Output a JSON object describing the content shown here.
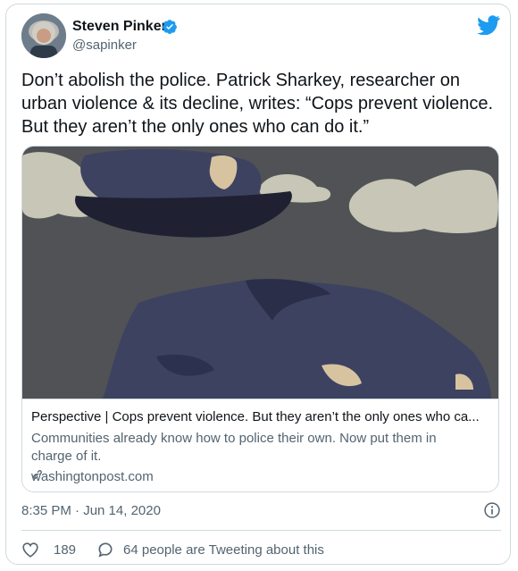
{
  "author": {
    "name": "Steven Pinker",
    "handle": "@sapinker"
  },
  "tweet_text": "Don’t abolish the police. Patrick Sharkey, researcher on urban violence & its decline, writes: “Cops prevent violence. But they aren’t the only ones who can do it.”",
  "link_card": {
    "title": "Perspective | Cops prevent violence. But they aren’t the only ones who ca...",
    "description": "Communities already know how to police their own. Now put them in charge of it.",
    "domain": "washingtonpost.com"
  },
  "timestamp": "8:35 PM · Jun 14, 2020",
  "engagement": {
    "likes": "189",
    "reply_text": "64 people are Tweeting about this"
  },
  "colors": {
    "brand_blue": "#1d9bf0",
    "text_primary": "#0f1419",
    "text_secondary": "#536471",
    "border": "#cfd9de"
  },
  "icons": {
    "verified": "verified-badge-icon",
    "logo": "twitter-bird-icon",
    "link": "link-icon",
    "info": "info-icon",
    "like": "heart-icon",
    "reply": "speech-bubble-icon"
  }
}
